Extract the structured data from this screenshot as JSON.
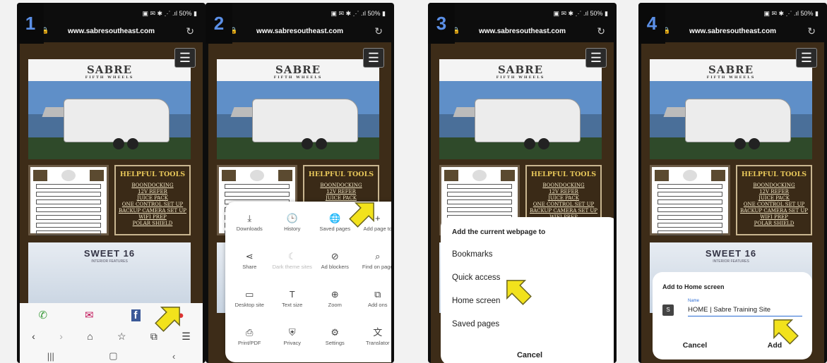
{
  "steps": [
    "1",
    "2",
    "3",
    "4"
  ],
  "status": {
    "battery": "50%"
  },
  "browser": {
    "url": "www.sabresoutheast.com"
  },
  "site": {
    "brand": "SABRE",
    "brand_sub": "FIFTH WHEELS",
    "tools_title": "HELPFUL TOOLS",
    "tools": [
      "BOONDOCKING",
      "12V REFER",
      "JUICE PACK",
      "ONE CONTROL SET UP",
      "BACKUP CAMERA SET UP",
      "WIFI PREP",
      "POLAR SHIELD"
    ],
    "promo_title": "SWEET 16",
    "promo_sub": "INTERIOR FEATURES"
  },
  "menu": {
    "items": [
      {
        "label": "Downloads",
        "icon": "⤓",
        "dim": false
      },
      {
        "label": "History",
        "icon": "🕒",
        "dim": false
      },
      {
        "label": "Saved pages",
        "icon": "🌐",
        "dim": false
      },
      {
        "label": "Add page to",
        "icon": "+",
        "dim": false
      },
      {
        "label": "Share",
        "icon": "⋖",
        "dim": false
      },
      {
        "label": "Dark theme sites",
        "icon": "☾",
        "dim": true
      },
      {
        "label": "Ad blockers",
        "icon": "⊘",
        "dim": false
      },
      {
        "label": "Find on page",
        "icon": "⌕",
        "dim": false
      },
      {
        "label": "Desktop site",
        "icon": "▭",
        "dim": false
      },
      {
        "label": "Text size",
        "icon": "T",
        "dim": false
      },
      {
        "label": "Zoom",
        "icon": "⊕",
        "dim": false
      },
      {
        "label": "Add ons",
        "icon": "⧉",
        "dim": false
      },
      {
        "label": "Print/PDF",
        "icon": "⎙",
        "dim": false
      },
      {
        "label": "Privacy",
        "icon": "⛨",
        "dim": false
      },
      {
        "label": "Settings",
        "icon": "⚙",
        "dim": false
      },
      {
        "label": "Translator",
        "icon": "文",
        "dim": false
      }
    ]
  },
  "add_dialog": {
    "title": "Add the current webpage to",
    "options": [
      "Bookmarks",
      "Quick access",
      "Home screen",
      "Saved pages"
    ],
    "cancel": "Cancel"
  },
  "home_dialog": {
    "title": "Add to Home screen",
    "icon_letter": "S",
    "name_label": "Name",
    "name_value": "HOME | Sabre Training Site",
    "cancel": "Cancel",
    "add": "Add"
  },
  "colors": {
    "arrow": "#f2e21c",
    "step_number": "#5b8fe6"
  }
}
